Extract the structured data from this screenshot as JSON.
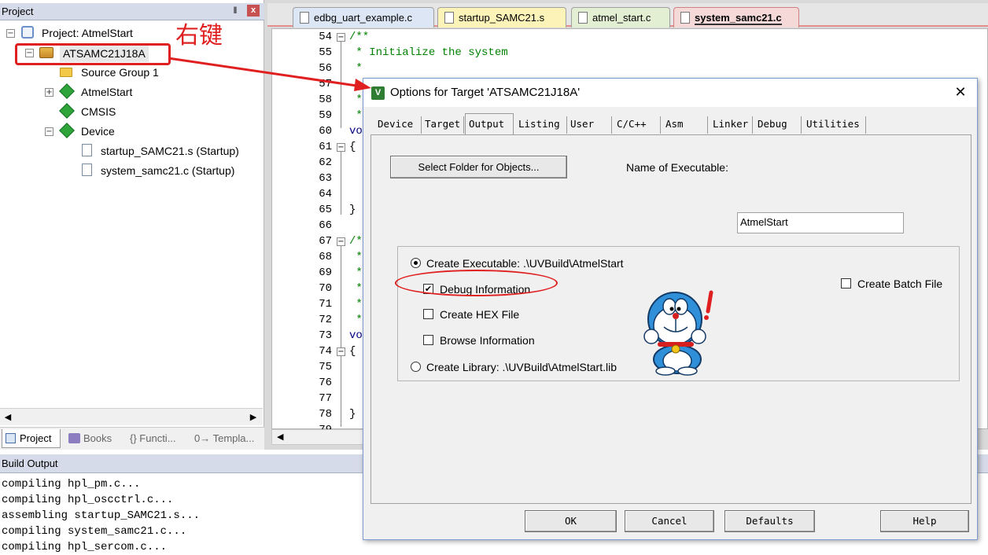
{
  "project_panel": {
    "title": "Project",
    "pin_glyph": "ᵖ",
    "close_glyph": "x",
    "tree": {
      "root": "Project: AtmelStart",
      "target": "ATSAMC21J18A",
      "children": [
        "Source Group 1",
        "AtmelStart",
        "CMSIS",
        "Device",
        "startup_SAMC21.s (Startup)",
        "system_samc21.c (Startup)"
      ]
    },
    "bottom_tabs": [
      "Project",
      "Books",
      "{} Functi...",
      "0→ Templa..."
    ]
  },
  "editor": {
    "file_tabs": [
      "edbg_uart_example.c",
      "startup_SAMC21.s",
      "atmel_start.c",
      "system_samc21.c"
    ],
    "active_tab": "system_samc21.c",
    "line_numbers": [
      "54",
      "55",
      "56",
      "57",
      "58",
      "59",
      "60",
      "61",
      "62",
      "63",
      "64",
      "65",
      "66",
      "67",
      "68",
      "69",
      "70",
      "71",
      "72",
      "73",
      "74",
      "75",
      "76",
      "77",
      "78",
      "79"
    ],
    "code": {
      "l54": "/**",
      "l55": " * Initialize the system",
      "l56": " *",
      "l58": " *",
      "l59": " *",
      "l60": "vo",
      "l61": "{",
      "l65": "}",
      "l67": "/*",
      "l68": " *",
      "l69": " *",
      "l70": " *",
      "l71": " *",
      "l72": " *",
      "l73": "vo",
      "l74": "{",
      "l78": "}"
    }
  },
  "build_output": {
    "title": "Build Output",
    "lines": [
      "compiling hpl_pm.c...",
      "compiling hpl_oscctrl.c...",
      "assembling startup_SAMC21.s...",
      "compiling system_samc21.c...",
      "compiling hpl_sercom.c..."
    ]
  },
  "dialog": {
    "icon_text": "V",
    "title": "Options for Target 'ATSAMC21J18A'",
    "close_glyph": "✕",
    "tabs": [
      "Device",
      "Target",
      "Output",
      "Listing",
      "User",
      "C/C++",
      "Asm",
      "Linker",
      "Debug",
      "Utilities"
    ],
    "active_tab": "Output",
    "select_folder_label": "Select Folder for Objects...",
    "name_of_executable_label": "Name of Executable:",
    "name_of_executable_value": "AtmelStart",
    "create_executable_label": "Create Executable:  .\\UVBuild\\AtmelStart",
    "debug_information_label": "Debug Information",
    "create_hex_label": "Create HEX File",
    "browse_information_label": "Browse Information",
    "create_library_label": "Create Library:  .\\UVBuild\\AtmelStart.lib",
    "create_batch_label": "Create Batch File",
    "state": {
      "create_executable": true,
      "debug_information": true,
      "create_hex": false,
      "browse_information": false,
      "create_library": false,
      "create_batch": false
    },
    "buttons": {
      "ok": "OK",
      "cancel": "Cancel",
      "defaults": "Defaults",
      "help": "Help"
    }
  },
  "annotation": {
    "text": "右键",
    "color": "#e02020"
  }
}
